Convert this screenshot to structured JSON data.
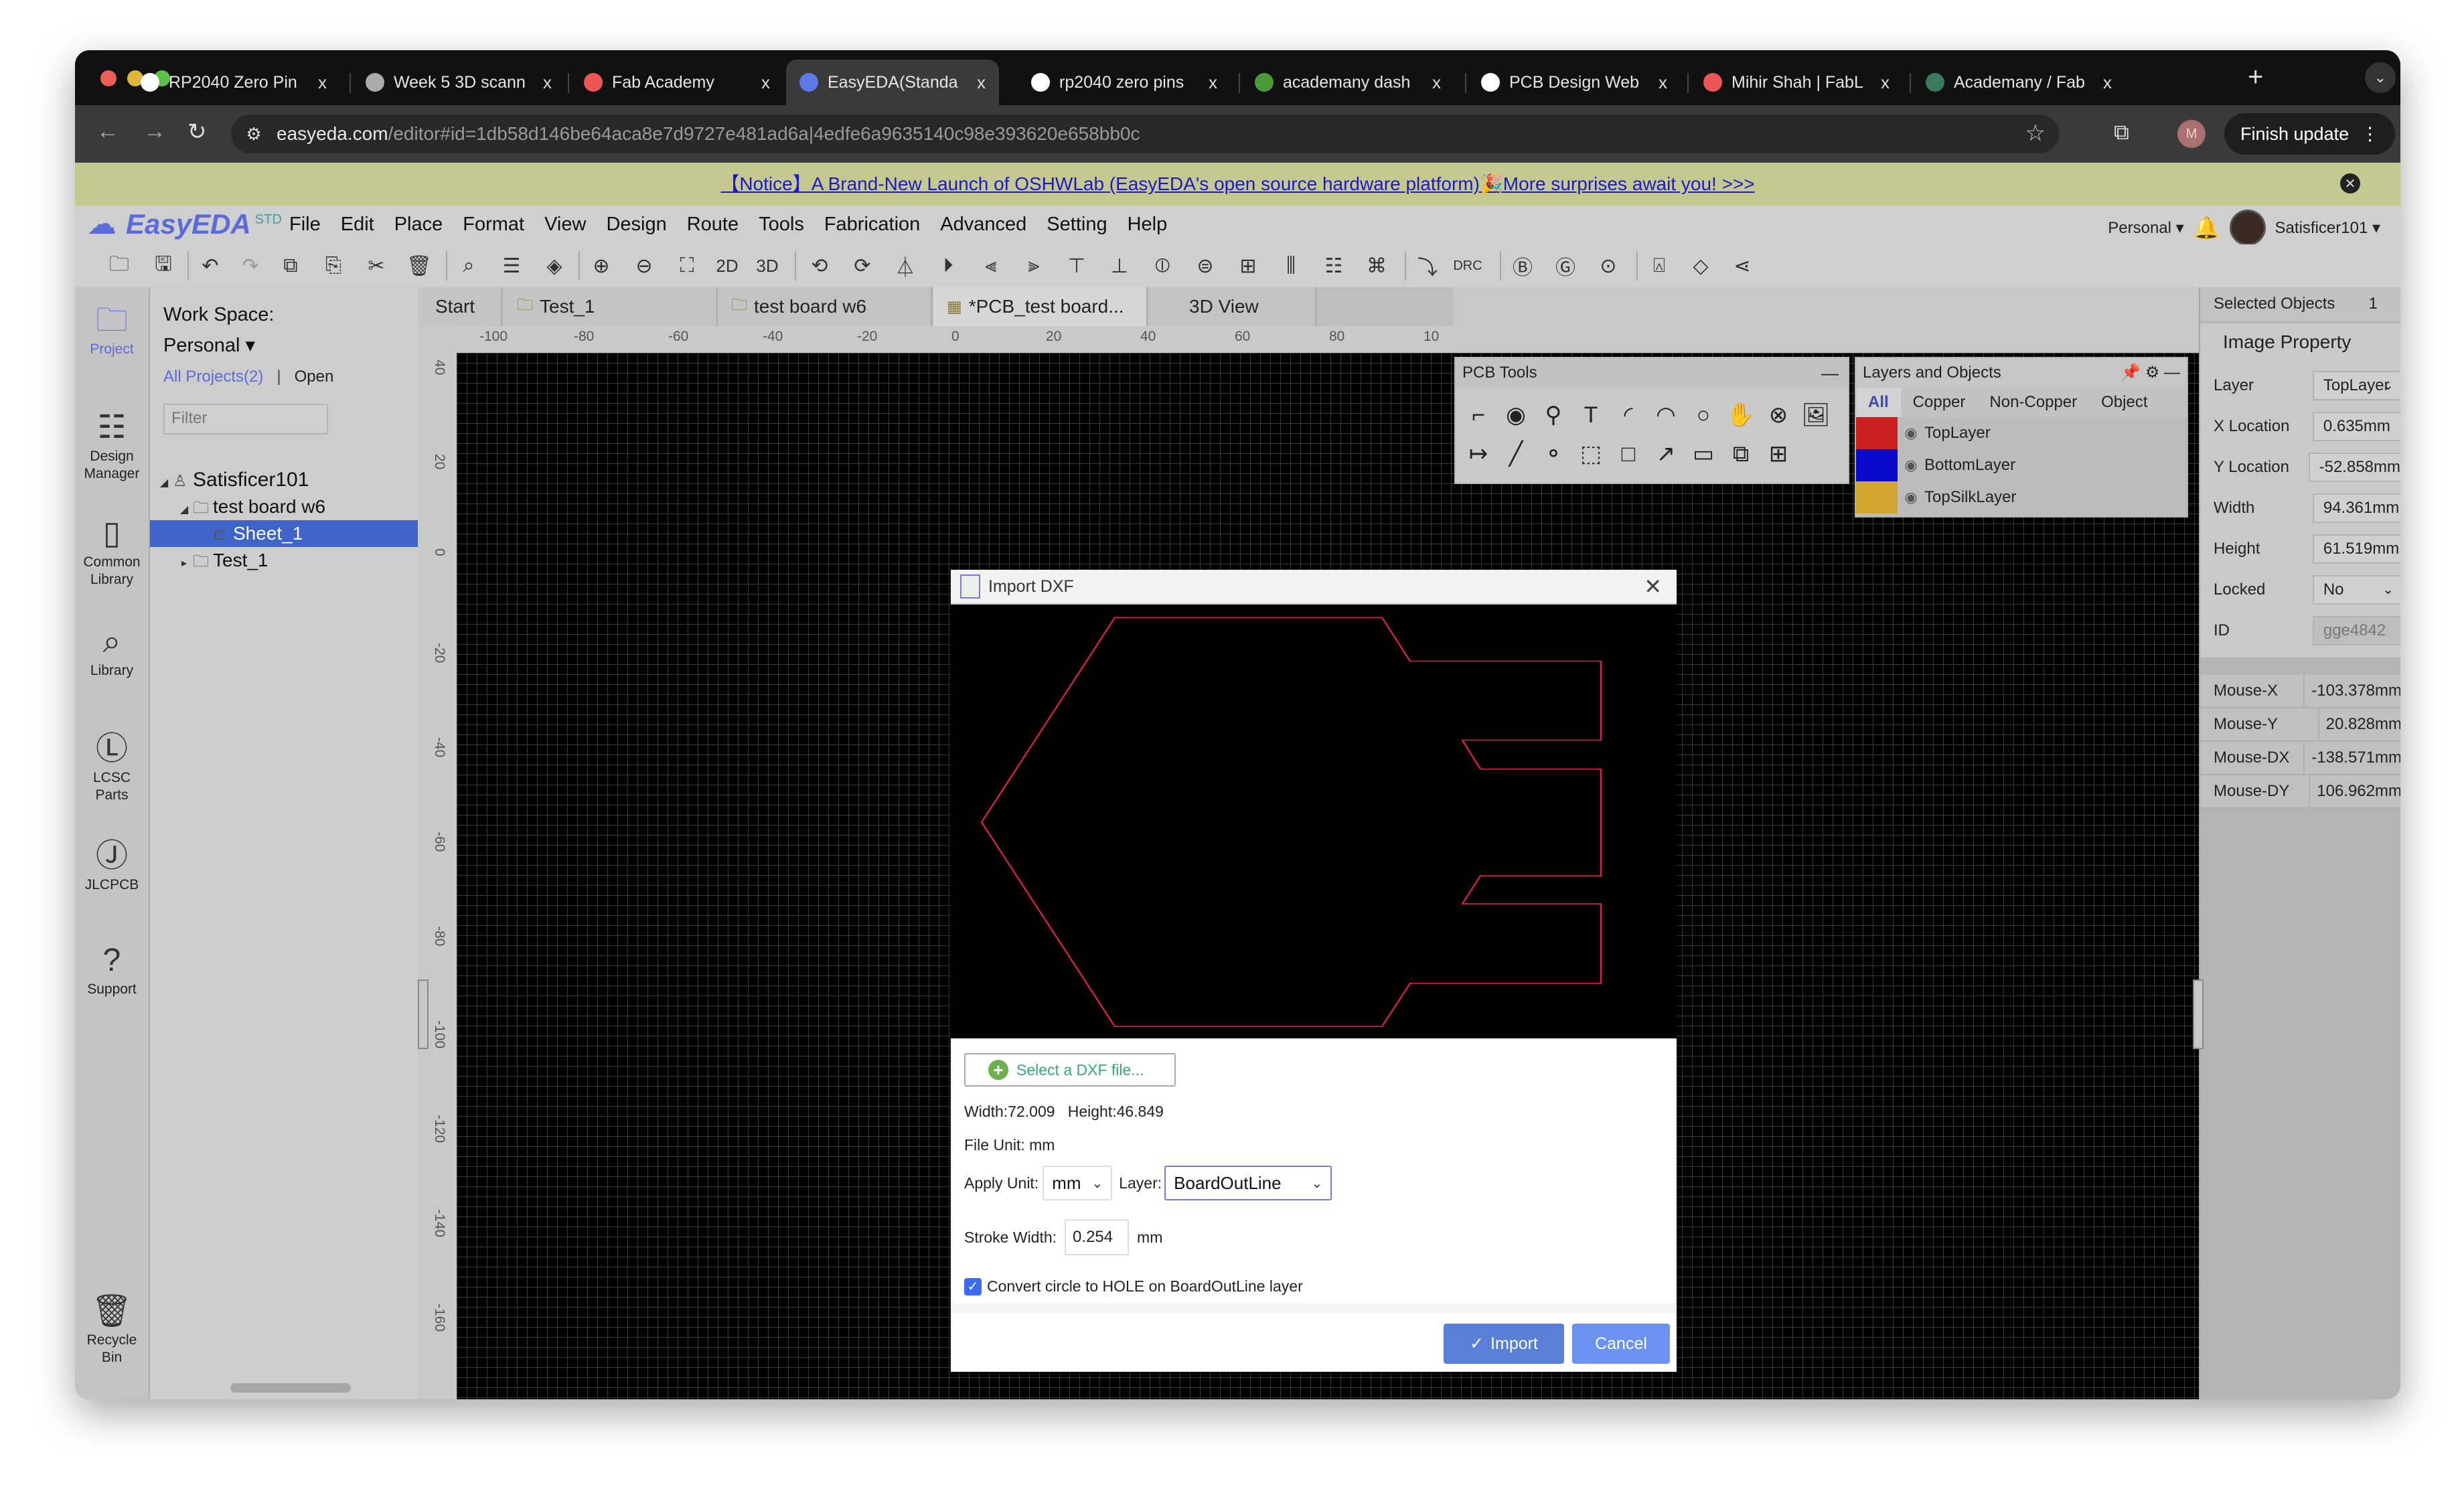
{
  "browser": {
    "tabs": [
      {
        "title": "RP2040 Zero Pin",
        "favicon": "openai-icon",
        "active": false
      },
      {
        "title": "Week 5 3D scann",
        "favicon": "globe-icon",
        "active": false
      },
      {
        "title": "Fab Academy",
        "favicon": "fablab-icon",
        "active": false
      },
      {
        "title": "EasyEDA(Standa",
        "favicon": "easyeda-icon",
        "active": true
      },
      {
        "title": "rp2040 zero pins",
        "favicon": "google-icon",
        "active": false
      },
      {
        "title": "academany dash",
        "favicon": "recycle-icon",
        "active": false
      },
      {
        "title": "PCB Design Web",
        "favicon": "openai-icon",
        "active": false
      },
      {
        "title": "Mihir Shah | FabL",
        "favicon": "fablab-icon",
        "active": false
      },
      {
        "title": "Academany / Fab",
        "favicon": "academany-icon",
        "active": false
      }
    ],
    "close_glyph": "x",
    "new_tab_glyph": "+",
    "url_host": "easyeda.com",
    "url_rest": "/editor#id=1db58d146be64aca8e7d9727e481ad6a|4edfe6a9635140c98e393620e658bb0c",
    "profile_initial": "M",
    "finish_update_label": "Finish update"
  },
  "notice": {
    "text": "【Notice】A Brand-New Launch of OSHWLab (EasyEDA's open source hardware platform)🎉More surprises await you! >>>"
  },
  "app": {
    "logo_name": "EasyEDA",
    "logo_badge": "STD",
    "menu": [
      "File",
      "Edit",
      "Place",
      "Format",
      "View",
      "Design",
      "Route",
      "Tools",
      "Fabrication",
      "Advanced",
      "Setting",
      "Help"
    ],
    "account": {
      "workspace": "Personal ▾",
      "username": "Satisficer101 ▾"
    },
    "toolbar_text": {
      "two_d": "2D",
      "three_d": "3D",
      "drc": "DRC"
    }
  },
  "rail": [
    {
      "label": "Project",
      "icon": "folder-icon",
      "active": true
    },
    {
      "label": "Design Manager",
      "icon": "design-manager-icon",
      "active": false
    },
    {
      "label": "Common Library",
      "icon": "chip-icon",
      "active": false
    },
    {
      "label": "Library",
      "icon": "library-search-icon",
      "active": false
    },
    {
      "label": "LCSC Parts",
      "icon": "lcsc-icon",
      "active": false
    },
    {
      "label": "JLCPCB",
      "icon": "jlc-icon",
      "active": false
    },
    {
      "label": "Support",
      "icon": "support-icon",
      "active": false
    },
    {
      "label": "Recycle Bin",
      "icon": "trash-icon",
      "active": false
    }
  ],
  "project_panel": {
    "workspace_label": "Work Space:",
    "workspace_value": "Personal ▾",
    "all_projects": "All Projects(2)",
    "separator": "|",
    "open": "Open",
    "filter_placeholder": "Filter",
    "tree": [
      {
        "label": "Satisficer101",
        "level": 0,
        "arrow": "◢",
        "icon": "user-icon",
        "selected": false
      },
      {
        "label": "test board w6",
        "level": 1,
        "arrow": "◢",
        "icon": "project-folder-icon",
        "selected": false
      },
      {
        "label": "Sheet_1",
        "level": 2,
        "arrow": "",
        "icon": "sheet-icon",
        "selected": true
      },
      {
        "label": "Test_1",
        "level": 1,
        "arrow": "▸",
        "icon": "project-folder-icon",
        "selected": false
      }
    ]
  },
  "doc_tabs": [
    {
      "label": "Start",
      "icon": "",
      "active": false
    },
    {
      "label": "Test_1",
      "icon": "folder-icon",
      "active": false
    },
    {
      "label": "test board w6",
      "icon": "folder-icon",
      "active": false
    },
    {
      "label": "*PCB_test board...",
      "icon": "pcb-icon",
      "active": true
    },
    {
      "label": "3D View",
      "icon": "",
      "active": false
    }
  ],
  "rulers": {
    "horizontal": [
      "-100",
      "-80",
      "-60",
      "-40",
      "-20",
      "0",
      "20",
      "40",
      "60",
      "80",
      "10"
    ],
    "vertical": [
      "40",
      "20",
      "0",
      "-20",
      "-40",
      "-60",
      "-80",
      "-100",
      "-120",
      "-140",
      "-160"
    ]
  },
  "pcb_tools": {
    "title": "PCB Tools",
    "minimize": "—",
    "tools": [
      "track",
      "pad",
      "via",
      "text",
      "arc",
      "center-arc",
      "circle",
      "pan",
      "hole",
      "image",
      "dimension",
      "line",
      "connect",
      "rect-region",
      "rect",
      "arrow",
      "solid-region",
      "group",
      "table"
    ]
  },
  "layers_panel": {
    "title": "Layers and Objects",
    "tabs": [
      "All",
      "Copper",
      "Non-Copper",
      "Object"
    ],
    "active_tab": "All",
    "layers": [
      {
        "name": "TopLayer",
        "color": "#cc1f1f"
      },
      {
        "name": "BottomLayer",
        "color": "#0a0acc"
      },
      {
        "name": "TopSilkLayer",
        "color": "#d4a52c"
      }
    ]
  },
  "properties": {
    "selected_label": "Selected Objects",
    "selected_count": "1",
    "section": "Image Property",
    "fields": [
      {
        "label": "Layer",
        "value": "TopLayer",
        "type": "select"
      },
      {
        "label": "X Location",
        "value": "0.635mm",
        "type": "input"
      },
      {
        "label": "Y Location",
        "value": "-52.858mm",
        "type": "input"
      },
      {
        "label": "Width",
        "value": "94.361mm",
        "type": "input"
      },
      {
        "label": "Height",
        "value": "61.519mm",
        "type": "input"
      },
      {
        "label": "Locked",
        "value": "No",
        "type": "select"
      },
      {
        "label": "ID",
        "value": "gge4842",
        "type": "disabled"
      }
    ],
    "mouse": [
      {
        "label": "Mouse-X",
        "value": "-103.378mm"
      },
      {
        "label": "Mouse-Y",
        "value": "20.828mm"
      },
      {
        "label": "Mouse-DX",
        "value": "-138.571mm"
      },
      {
        "label": "Mouse-DY",
        "value": "106.962mm"
      }
    ]
  },
  "import_dxf": {
    "title": "Import DXF",
    "outline_color": "#e0204a",
    "select_file_label": "Select a DXF file...",
    "width_text": "Width:72.009",
    "height_text": "Height:46.849",
    "file_unit_text": "File Unit:  mm",
    "apply_unit_label": "Apply Unit:",
    "apply_unit_value": "mm",
    "layer_label": "Layer:",
    "layer_value": "BoardOutLine",
    "stroke_width_label": "Stroke Width:",
    "stroke_width_value": "0.254",
    "stroke_width_unit": "mm",
    "convert_checked": true,
    "convert_label": "Convert circle to HOLE on BoardOutLine layer",
    "import_label": "Import",
    "cancel_label": "Cancel"
  }
}
